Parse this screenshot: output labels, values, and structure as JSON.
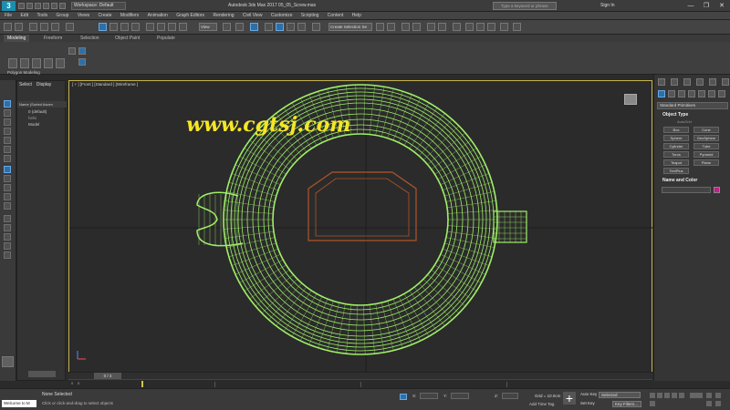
{
  "title_bar": {
    "logo": "3",
    "workspace": "Workspace: Default",
    "window_title": "Autodesk 3ds Max 2017    05_05_Screw.max",
    "search_placeholder": "Type a keyword or phrase",
    "sign_in": "Sign In",
    "minimize": "—",
    "maximize": "❐",
    "close": "✕"
  },
  "menu": [
    "File",
    "Edit",
    "Tools",
    "Group",
    "Views",
    "Create",
    "Modifiers",
    "Animation",
    "Graph Editors",
    "Rendering",
    "Civil View",
    "Customize",
    "Scripting",
    "Content",
    "Help"
  ],
  "toolbar": {
    "view_dropdown": "View",
    "selection_set": "Create Selection Se"
  },
  "ribbon": {
    "tabs": [
      "Modeling",
      "Freeform",
      "Selection",
      "Object Paint",
      "Populate"
    ],
    "panel_label": "Polygon Modeling"
  },
  "scene_explorer": {
    "tabs": [
      "Select",
      "Display"
    ],
    "header": "Name (Sorted Ascen",
    "rows": [
      "0 (default)",
      "helix",
      "Model"
    ]
  },
  "viewport": {
    "label": "[ + ] [Front ] [Standard ] [Wireframe ]"
  },
  "watermark": "www.cgtsj.com",
  "command_panel": {
    "dropdown": "Standard Primitives",
    "object_type_title": "Object Type",
    "autogrid": "AutoGrid",
    "objects": [
      "Box",
      "Cone",
      "Sphere",
      "GeoSphere",
      "Cylinder",
      "Tube",
      "Torus",
      "Pyramid",
      "Teapot",
      "Plane",
      "TextPlus"
    ],
    "name_color_title": "Name and Color",
    "swatch_color": "#c0208a"
  },
  "time": {
    "frame_label": "0 / 4",
    "track_numbers": [
      "0",
      "5"
    ]
  },
  "status": {
    "welcome": "Welcome to M",
    "selection": "None Selected",
    "hint": "Click or click-and-drag to select objects",
    "x_label": "X:",
    "y_label": "Y:",
    "z_label": "Z:",
    "grid": "Grid = 10.0cm",
    "add_time_tag": "Add Time Tag",
    "auto_key": "Auto Key",
    "set_key": "Set Key",
    "selected_dropdown": "Selected",
    "key_filters": "Key Filters..."
  },
  "colors": {
    "wireframe": "#9ff068",
    "inner_box": "#b0552a",
    "viewport_border": "#c7b34a",
    "watermark": "#f5e625"
  }
}
